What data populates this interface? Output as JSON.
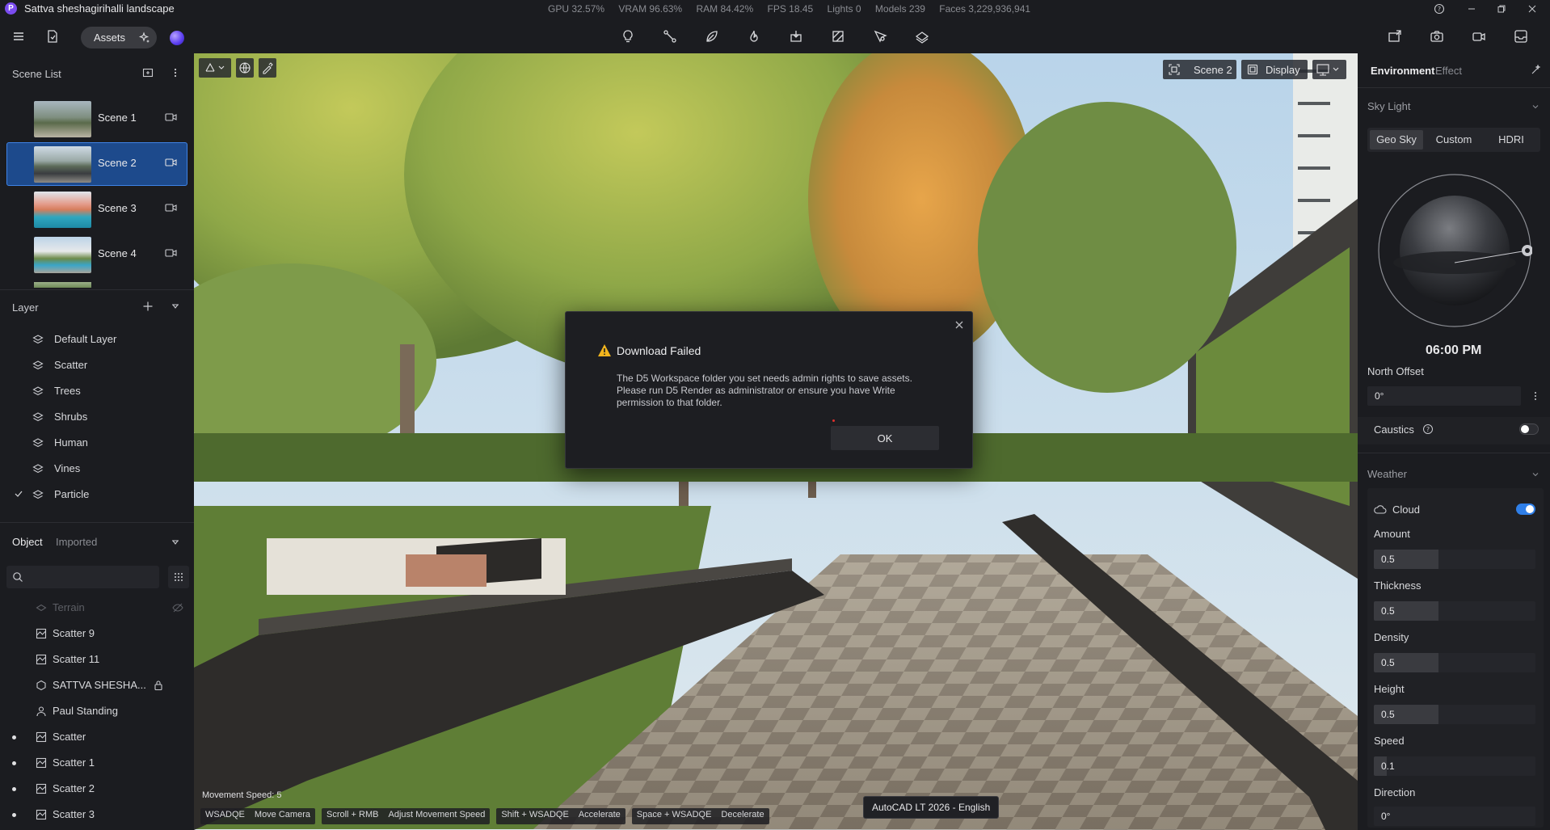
{
  "app": {
    "title": "Sattva sheshagirihalli landscape",
    "logo_letter": "P"
  },
  "stats": {
    "gpu": "GPU 32.57%",
    "vram": "VRAM 96.63%",
    "ram": "RAM 84.42%",
    "fps": "FPS 18.45",
    "lights": "Lights 0",
    "models": "Models 239",
    "faces": "Faces 3,229,936,941"
  },
  "toolbar": {
    "assets_label": "Assets"
  },
  "scene_list": {
    "title": "Scene List",
    "items": [
      {
        "label": "Scene 1",
        "selected": false
      },
      {
        "label": "Scene 2",
        "selected": true
      },
      {
        "label": "Scene 3",
        "selected": false
      },
      {
        "label": "Scene 4",
        "selected": false
      }
    ]
  },
  "layer": {
    "title": "Layer",
    "items": [
      "Default Layer",
      "Scatter",
      "Trees",
      "Shrubs",
      "Human",
      "Vines",
      "Particle"
    ]
  },
  "objects": {
    "tab_object": "Object",
    "tab_imported": "Imported",
    "search_placeholder": "",
    "items": [
      {
        "label": "Terrain",
        "dimmed": true
      },
      {
        "label": "Scatter 9"
      },
      {
        "label": "Scatter 11"
      },
      {
        "label": "SATTVA SHESHA..."
      },
      {
        "label": "Paul Standing"
      },
      {
        "label": "Scatter"
      },
      {
        "label": "Scatter 1"
      },
      {
        "label": "Scatter 2"
      },
      {
        "label": "Scatter 3"
      }
    ]
  },
  "viewport": {
    "scene_chip": "Scene 2",
    "display_chip": "Display",
    "movement_speed": "Movement Speed: 5",
    "hints": [
      {
        "key": "WSADQE",
        "action": "Move Camera"
      },
      {
        "key": "Scroll + RMB",
        "action": "Adjust Movement Speed"
      },
      {
        "key": "Shift + WSADQE",
        "action": "Accelerate"
      },
      {
        "key": "Space + WSADQE",
        "action": "Decelerate"
      }
    ],
    "taskbar_tooltip": "AutoCAD LT 2026 - English"
  },
  "dialog": {
    "title": "Download Failed",
    "body": "The D5 Workspace folder you set needs admin rights to save assets. Please run D5 Render as administrator or ensure you have Write permission to that folder.",
    "ok_label": "OK"
  },
  "right_panel": {
    "tab_environment": "Environment",
    "tab_effect": "Effect",
    "sky_light": "Sky Light",
    "sky_modes": [
      "Geo Sky",
      "Custom",
      "HDRI"
    ],
    "time": "06:00 PM",
    "north_offset_label": "North Offset",
    "north_offset_value": "0°",
    "caustics_label": "Caustics",
    "weather": "Weather",
    "cloud_label": "Cloud",
    "amount_label": "Amount",
    "amount_value": "0.5",
    "amount_fraction": 0.4,
    "thickness_label": "Thickness",
    "thickness_value": "0.5",
    "thickness_fraction": 0.4,
    "density_label": "Density",
    "density_value": "0.5",
    "density_fraction": 0.4,
    "height_label": "Height",
    "height_value": "0.5",
    "height_fraction": 0.4,
    "speed_label": "Speed",
    "speed_value": "0.1",
    "speed_fraction": 0.08,
    "direction_label": "Direction",
    "direction_value": "0°"
  },
  "colors": {
    "accent": "#3f83e6",
    "selected_bg": "#1d4a8c",
    "panel": "#1b1c20",
    "warning": "#f2b51d"
  }
}
